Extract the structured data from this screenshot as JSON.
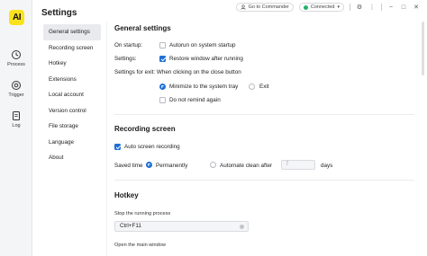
{
  "app": {
    "logo_text": "AI",
    "title": "Settings"
  },
  "rail": {
    "items": [
      {
        "label": "Process",
        "icon": "process-icon"
      },
      {
        "label": "Trigger",
        "icon": "trigger-icon"
      },
      {
        "label": "Log",
        "icon": "log-icon"
      }
    ]
  },
  "topbar": {
    "commander": "Go to Commander",
    "status": "Connected",
    "status_color": "#23b26d"
  },
  "nav": {
    "items": [
      "General settings",
      "Recording screen",
      "Hotkey",
      "Extensions",
      "Local account",
      "Version control",
      "File storage",
      "Language",
      "About"
    ],
    "active_index": 0
  },
  "general": {
    "title": "General settings",
    "startup_label": "On startup:",
    "autorun": "Autorun on system startup",
    "settings_label": "Settings:",
    "restore": "Restore window after running",
    "exit_label": "Settings for exit: When clicking on the close button",
    "minimize": "Minimize to the system tray",
    "exit": "Exit",
    "no_remind": "Do not remind again"
  },
  "recording": {
    "title": "Recording screen",
    "auto": "Auto screen recording",
    "saved_label": "Saved time",
    "permanently": "Permanently",
    "automate": "Automate clean after",
    "days_placeholder": "7",
    "days": "days"
  },
  "hotkey": {
    "title": "Hotkey",
    "stop_label": "Stop the running process",
    "stop_value": "Ctrl+F11",
    "open_label": "Open the main window"
  },
  "accent_color": "#1e6fd6"
}
